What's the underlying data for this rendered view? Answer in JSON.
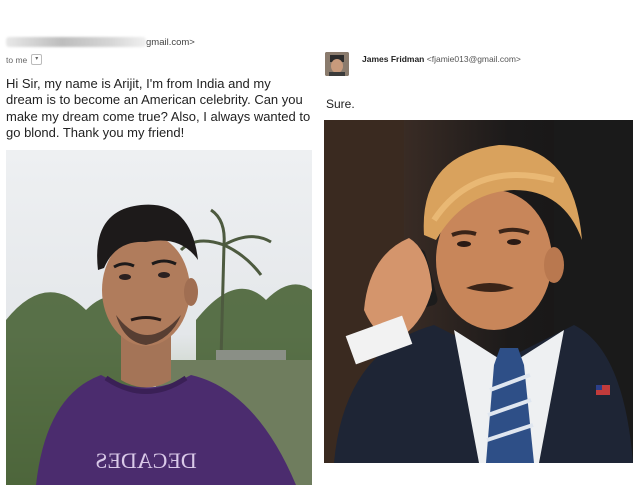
{
  "email": {
    "sender_domain": "gmail.com>",
    "to_label": "to me",
    "message": "Hi Sir, my name is Arijit, I'm from India and my dream is to become an American celebrity. Can you make my dream come true? Also, I always wanted to go blond. Thank you my friend!",
    "shirt_text": "DECADES"
  },
  "reply": {
    "sender_name": "James Fridman",
    "sender_email": "<fjamie013@gmail.com>",
    "text": "Sure."
  },
  "icons": {
    "dropdown": "chevron-down-icon",
    "avatar": "avatar"
  }
}
